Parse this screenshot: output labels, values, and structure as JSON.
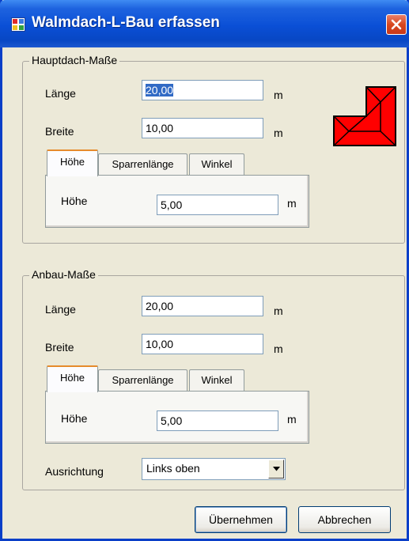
{
  "window": {
    "title": "Walmdach-L-Bau erfassen",
    "icon": "app-window-icon",
    "close_icon": "close-icon"
  },
  "main_roof": {
    "legend": "Hauptdach-Maße",
    "length_label": "Länge",
    "length_value": "20,00",
    "length_unit": "m",
    "width_label": "Breite",
    "width_value": "10,00",
    "width_unit": "m",
    "tabs": [
      "Höhe",
      "Sparrenlänge",
      "Winkel"
    ],
    "active_tab": "Höhe",
    "height_label": "Höhe",
    "height_value": "5,00",
    "height_unit": "m",
    "preview_icon": "l-shaped-hip-roof-icon",
    "preview_color": "#ff0000"
  },
  "annex": {
    "legend": "Anbau-Maße",
    "length_label": "Länge",
    "length_value": "20,00",
    "length_unit": "m",
    "width_label": "Breite",
    "width_value": "10,00",
    "width_unit": "m",
    "tabs": [
      "Höhe",
      "Sparrenlänge",
      "Winkel"
    ],
    "active_tab": "Höhe",
    "height_label": "Höhe",
    "height_value": "5,00",
    "height_unit": "m",
    "orientation_label": "Ausrichtung",
    "orientation_value": "Links oben"
  },
  "buttons": {
    "apply": "Übernehmen",
    "cancel": "Abbrechen"
  },
  "colors": {
    "titlebar": "#0a4fd6",
    "dialog_bg": "#ece9d8",
    "selection": "#316ac5",
    "close": "#d8481f"
  }
}
